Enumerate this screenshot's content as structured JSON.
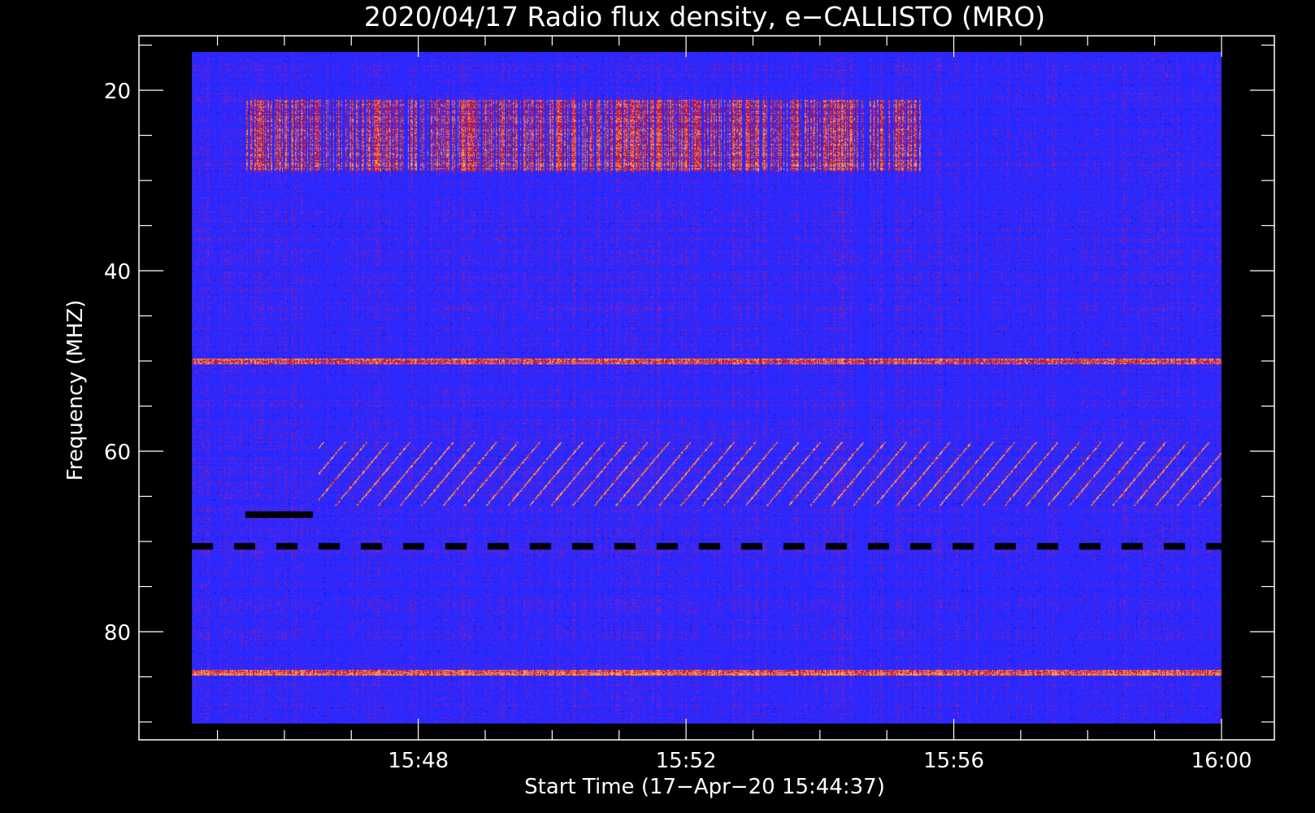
{
  "chart_data": {
    "type": "heatmap",
    "title": "2020/04/17  Radio flux density, e−CALLISTO (MRO)",
    "xlabel": "Start Time (17−Apr−20 15:44:37)",
    "ylabel": "Frequency (MHZ)",
    "x_range": [
      "15:44:37",
      "16:00:00"
    ],
    "x_ticks": [
      "15:48",
      "15:52",
      "15:56",
      "16:00"
    ],
    "ylim": [
      90,
      14
    ],
    "y_ticks": [
      20,
      40,
      60,
      80
    ],
    "y_minor_step": 5,
    "x_minor_step_minutes": 1,
    "colormap": [
      "#000000",
      "#0b0b8c",
      "#2a2ad8",
      "#3a3aff",
      "#8a1fb0",
      "#b01818",
      "#e03a1a",
      "#ffb070"
    ],
    "features": [
      {
        "name": "horizontal band",
        "frequency_range": [
          21,
          29
        ],
        "time_range": [
          "15:45:25",
          "15:55:30"
        ]
      },
      {
        "name": "horizontal line",
        "frequency": 50
      },
      {
        "name": "drifting bursts",
        "frequency_range": [
          59,
          66
        ],
        "time_range": [
          "15:46:30",
          "16:00:00"
        ]
      },
      {
        "name": "dropout line",
        "frequency": 67,
        "time_range": [
          "15:45:25",
          "15:46:25"
        ]
      },
      {
        "name": "dashed dropout",
        "frequency": 70.5
      },
      {
        "name": "horizontal line",
        "frequency": 84.5
      }
    ]
  }
}
